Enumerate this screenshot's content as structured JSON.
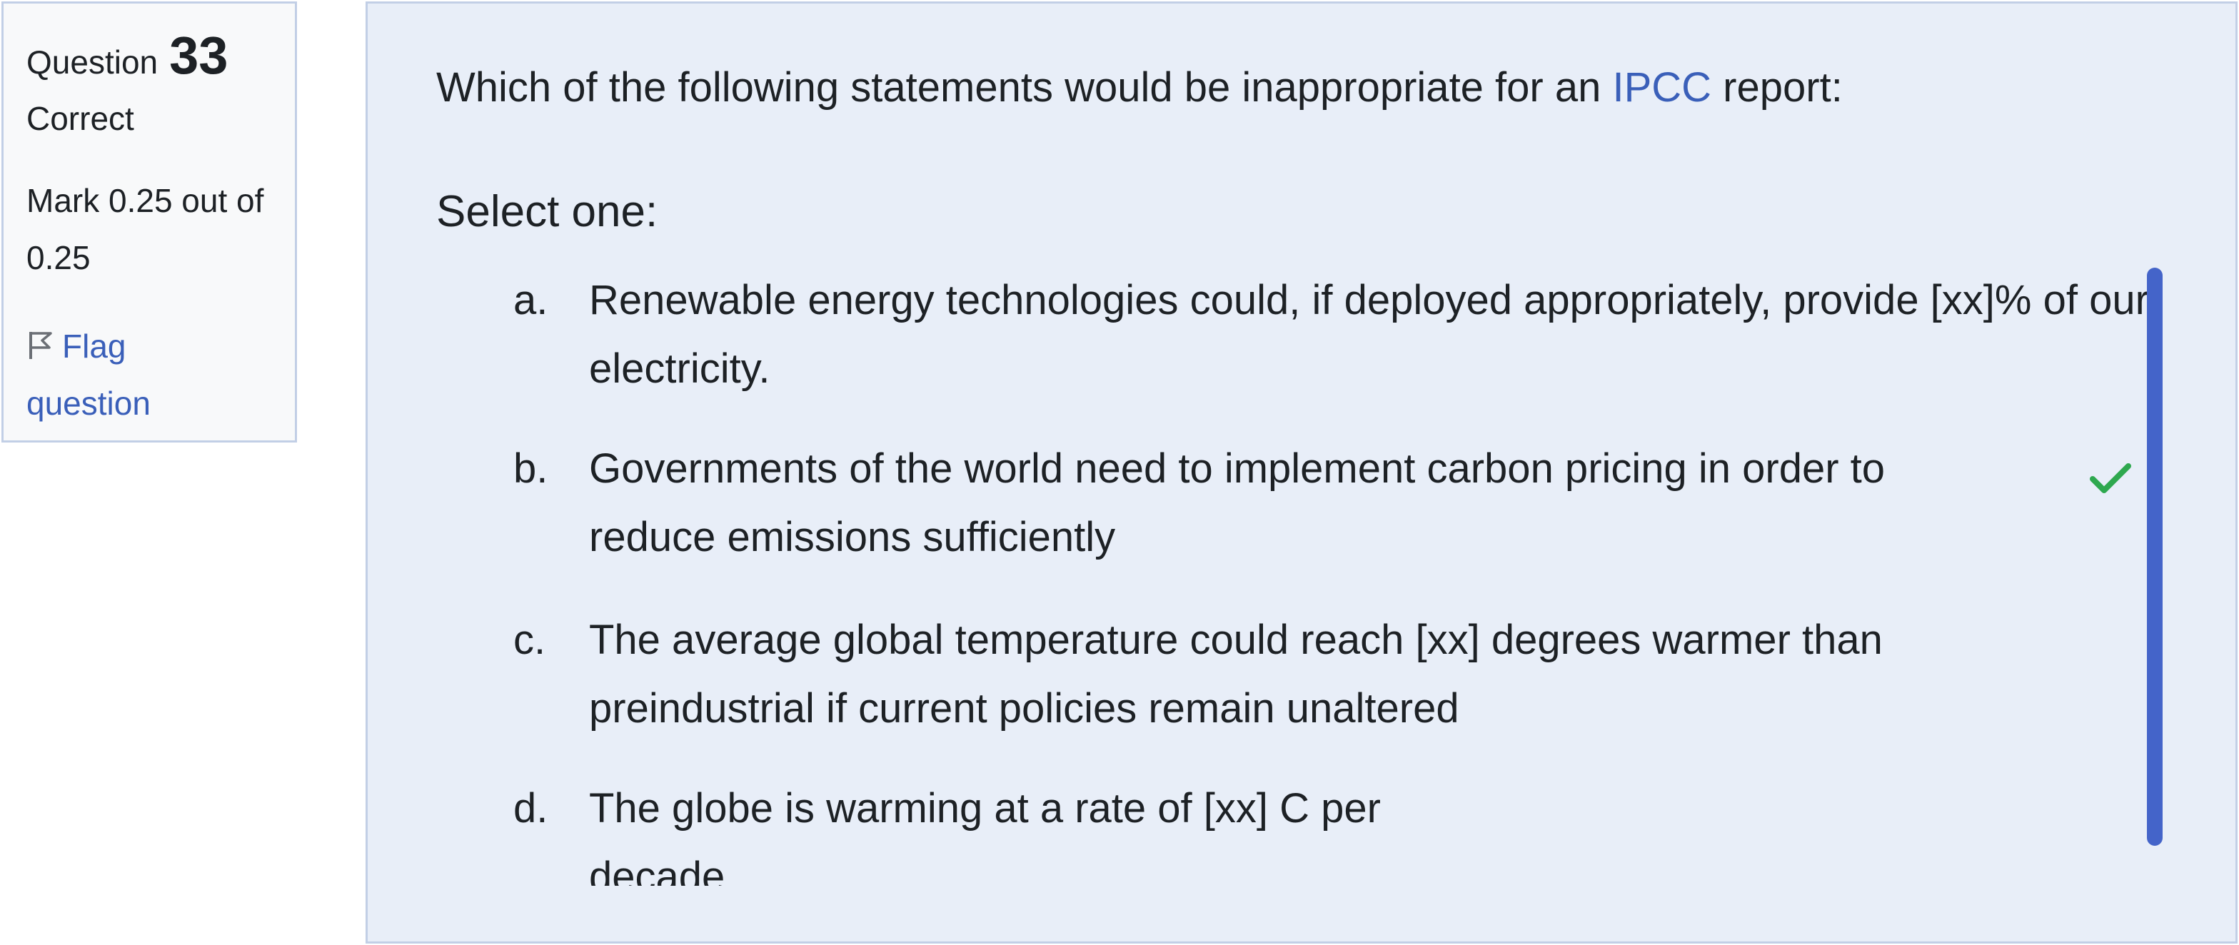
{
  "info": {
    "question_label": "Question",
    "question_number": "33",
    "state": "Correct",
    "grade": "Mark 0.25 out of 0.25",
    "flag_label": "Flag question",
    "flag_icon": "flag-outline-icon"
  },
  "question": {
    "text_before": "Which of the following statements would be inappropriate for an ",
    "link_text": "IPCC",
    "text_after": " report:",
    "prompt": "Select one:"
  },
  "answers": [
    {
      "letter": "a.",
      "text": "Renewable energy technologies could, if deployed appropriately, provide [xx]% of our electricity."
    },
    {
      "letter": "b.",
      "text": "Governments of the world need to implement carbon pricing in order to reduce emissions sufficiently"
    },
    {
      "letter": "c.",
      "text": "The average global temperature could reach [xx] degrees warmer than preindustrial if current policies remain unaltered"
    },
    {
      "letter": "d.",
      "text": "The globe is warming at a rate of [xx] C per decade"
    }
  ],
  "feedback": {
    "correct_icon": "checkmark-icon",
    "correct_color": "#2ea84f"
  },
  "colors": {
    "link": "#3a5fb9",
    "panel_bg": "#e8eef8",
    "info_bg": "#f8f9fa",
    "border": "#c2cfe6",
    "scrollbar": "#4464c9"
  }
}
